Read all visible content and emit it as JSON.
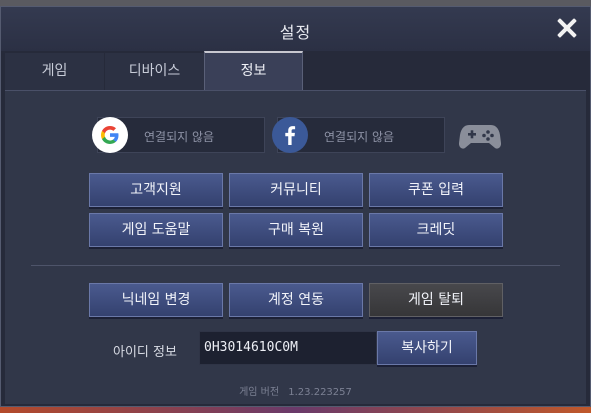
{
  "dialog": {
    "title": "설정",
    "close_icon": "close-icon"
  },
  "tabs": [
    {
      "label": "게임",
      "active": false
    },
    {
      "label": "디바이스",
      "active": false
    },
    {
      "label": "정보",
      "active": true
    }
  ],
  "accounts": {
    "google": {
      "icon": "google-icon",
      "status": "연결되지 않음"
    },
    "facebook": {
      "icon": "facebook-icon",
      "status": "연결되지 않음"
    },
    "gamepad": {
      "icon": "gamepad-icon"
    }
  },
  "buttons": {
    "support": "고객지원",
    "community": "커뮤니티",
    "coupon": "쿠폰 입력",
    "help": "게임 도움말",
    "restore": "구매 복원",
    "credits": "크레딧",
    "nickname": "닉네임 변경",
    "link_account": "계정 연동",
    "withdraw": "게임 탈퇴"
  },
  "id_info": {
    "label": "아이디 정보",
    "value": "0H3014610C0M",
    "copy_label": "복사하기"
  },
  "version": {
    "label": "게임 버전",
    "value": "1.23.223257"
  },
  "colors": {
    "primary_button": "#3d4b7e",
    "danger_button": "#3e3e42",
    "panel": "#313749",
    "title_bar": "#2f3549"
  }
}
